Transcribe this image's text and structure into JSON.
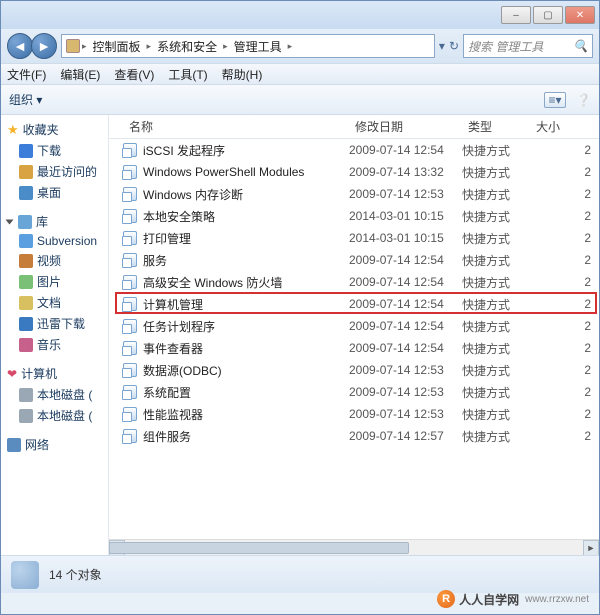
{
  "window_controls": {
    "min": "–",
    "max": "▢",
    "close": "✕"
  },
  "breadcrumb": {
    "root_icon": "control-panel",
    "parts": [
      "控制面板",
      "系统和安全",
      "管理工具"
    ]
  },
  "search": {
    "placeholder": "搜索 管理工具"
  },
  "menu": {
    "file": "文件(F)",
    "edit": "编辑(E)",
    "view": "查看(V)",
    "tools": "工具(T)",
    "help": "帮助(H)"
  },
  "toolbar": {
    "organize": "组织",
    "organize_arrow": "▾"
  },
  "sidebar": {
    "favorites_label": "收藏夹",
    "favorites": [
      {
        "icon": "ic-dl",
        "label": "下载"
      },
      {
        "icon": "ic-recent",
        "label": "最近访问的"
      },
      {
        "icon": "ic-desk",
        "label": "桌面"
      }
    ],
    "libraries_label": "库",
    "libraries": [
      {
        "icon": "ic-sub",
        "label": "Subversion"
      },
      {
        "icon": "ic-vid",
        "label": "视频"
      },
      {
        "icon": "ic-pic",
        "label": "图片"
      },
      {
        "icon": "ic-doc",
        "label": "文档"
      },
      {
        "icon": "ic-xldl",
        "label": "迅雷下载"
      },
      {
        "icon": "ic-music",
        "label": "音乐"
      }
    ],
    "computer_label": "计算机",
    "drives": [
      {
        "icon": "ic-drive",
        "label": "本地磁盘 ("
      },
      {
        "icon": "ic-drive",
        "label": "本地磁盘 ("
      }
    ],
    "network_label": "网络"
  },
  "columns": {
    "name": "名称",
    "date": "修改日期",
    "type": "类型",
    "size": "大小"
  },
  "files": [
    {
      "name": "iSCSI 发起程序",
      "date": "2009-07-14 12:54",
      "type": "快捷方式",
      "size": "2"
    },
    {
      "name": "Windows PowerShell Modules",
      "date": "2009-07-14 13:32",
      "type": "快捷方式",
      "size": "2"
    },
    {
      "name": "Windows 内存诊断",
      "date": "2009-07-14 12:53",
      "type": "快捷方式",
      "size": "2"
    },
    {
      "name": "本地安全策略",
      "date": "2014-03-01 10:15",
      "type": "快捷方式",
      "size": "2"
    },
    {
      "name": "打印管理",
      "date": "2014-03-01 10:15",
      "type": "快捷方式",
      "size": "2"
    },
    {
      "name": "服务",
      "date": "2009-07-14 12:54",
      "type": "快捷方式",
      "size": "2"
    },
    {
      "name": "高级安全 Windows 防火墙",
      "date": "2009-07-14 12:54",
      "type": "快捷方式",
      "size": "2"
    },
    {
      "name": "计算机管理",
      "date": "2009-07-14 12:54",
      "type": "快捷方式",
      "size": "2",
      "highlight": true
    },
    {
      "name": "任务计划程序",
      "date": "2009-07-14 12:54",
      "type": "快捷方式",
      "size": "2"
    },
    {
      "name": "事件查看器",
      "date": "2009-07-14 12:54",
      "type": "快捷方式",
      "size": "2"
    },
    {
      "name": "数据源(ODBC)",
      "date": "2009-07-14 12:53",
      "type": "快捷方式",
      "size": "2"
    },
    {
      "name": "系统配置",
      "date": "2009-07-14 12:53",
      "type": "快捷方式",
      "size": "2"
    },
    {
      "name": "性能监视器",
      "date": "2009-07-14 12:53",
      "type": "快捷方式",
      "size": "2"
    },
    {
      "name": "组件服务",
      "date": "2009-07-14 12:57",
      "type": "快捷方式",
      "size": "2"
    }
  ],
  "status": {
    "count_text": "14 个对象"
  },
  "watermark": {
    "logo": "R",
    "text": "人人自学网",
    "url": "www.rrzxw.net"
  }
}
